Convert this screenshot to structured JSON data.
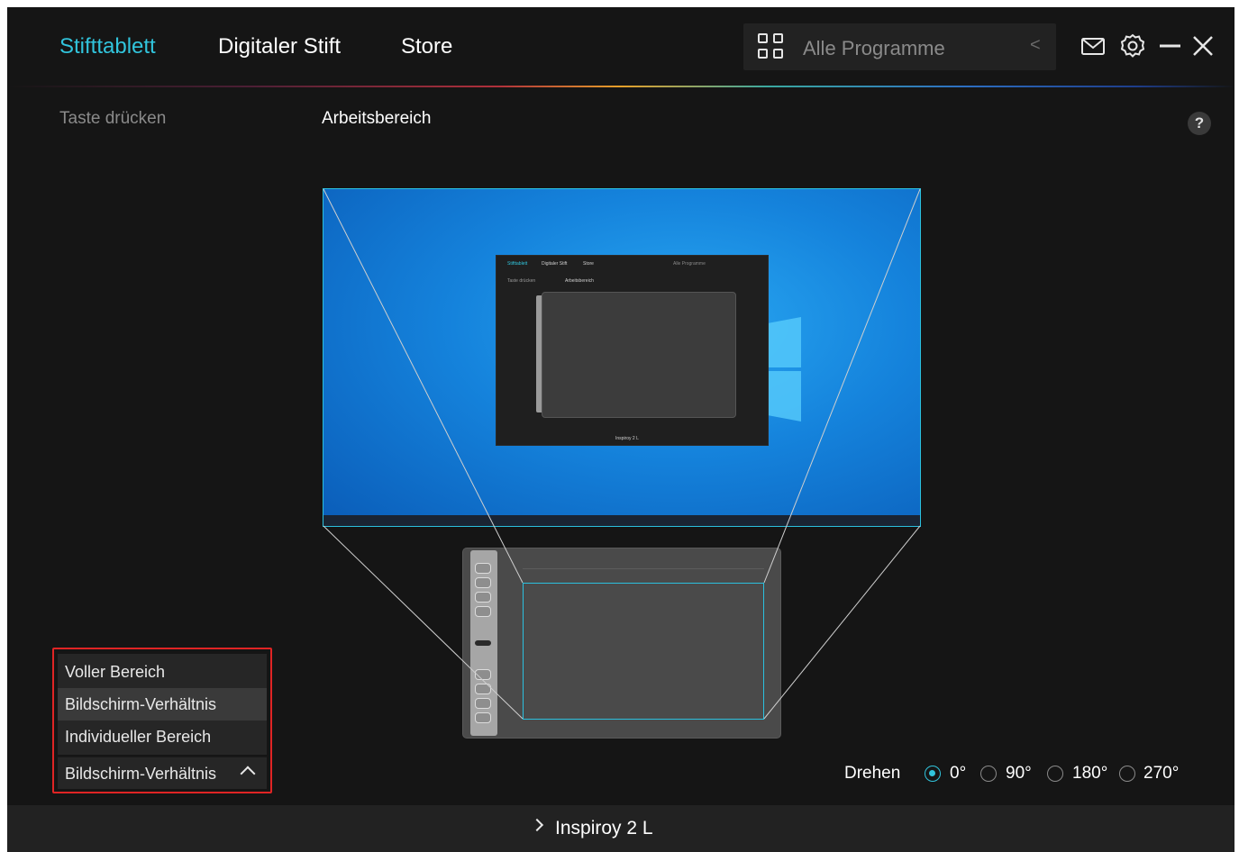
{
  "nav": {
    "tabs": [
      {
        "label": "Stifttablett",
        "active": true
      },
      {
        "label": "Digitaler Stift",
        "active": false
      },
      {
        "label": "Store",
        "active": false
      }
    ],
    "program_selector": {
      "label": "Alle Programme",
      "icon": "grid-icon",
      "arrow_icon": "chevron-left-icon"
    },
    "icons": [
      "mail-icon",
      "gear-icon",
      "minimize-icon",
      "close-icon"
    ]
  },
  "subnav": {
    "tabs": [
      {
        "label": "Taste drücken",
        "active": false
      },
      {
        "label": "Arbeitsbereich",
        "active": true
      }
    ],
    "help_label": "?"
  },
  "mapping_dropdown": {
    "options": [
      "Voller Bereich",
      "Bildschirm-Verhältnis",
      "Individueller Bereich"
    ],
    "highlighted": "Bildschirm-Verhältnis",
    "selected": "Bildschirm-Verhältnis"
  },
  "rotate": {
    "label": "Drehen",
    "options": [
      "0°",
      "90°",
      "180°",
      "270°"
    ],
    "selected": "0°"
  },
  "footer": {
    "device_label": "Inspiroy 2 L"
  },
  "colors": {
    "accent": "#31c4dc",
    "background": "#151515",
    "highlight_box": "#e02424"
  }
}
